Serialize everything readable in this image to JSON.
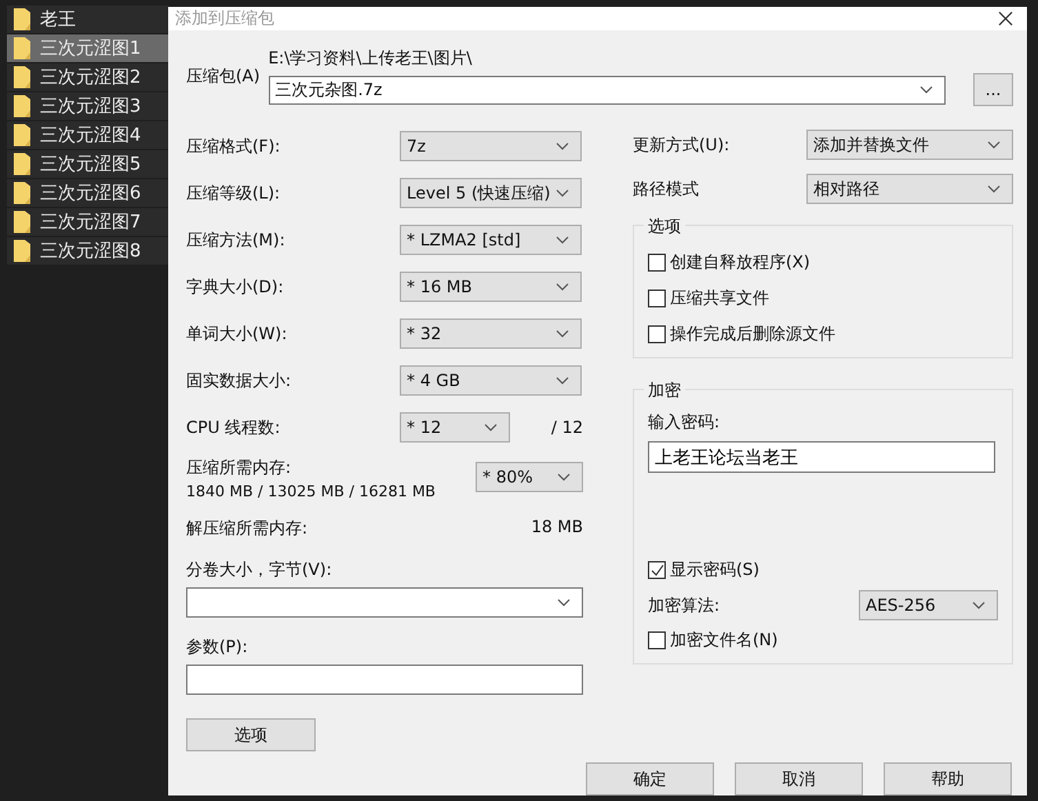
{
  "file_list": [
    {
      "name": "老王",
      "selected": false
    },
    {
      "name": "三次元涩图1",
      "selected": true
    },
    {
      "name": "三次元涩图2",
      "selected": false
    },
    {
      "name": "三次元涩图3",
      "selected": false
    },
    {
      "name": "三次元涩图4",
      "selected": false
    },
    {
      "name": "三次元涩图5",
      "selected": false
    },
    {
      "name": "三次元涩图6",
      "selected": false
    },
    {
      "name": "三次元涩图7",
      "selected": false
    },
    {
      "name": "三次元涩图8",
      "selected": false
    }
  ],
  "dialog": {
    "title": "添加到压缩包",
    "archive": {
      "label": "压缩包(A)",
      "path": "E:\\学习资料\\上传老王\\图片\\",
      "filename": "三次元杂图.7z",
      "browse": "..."
    },
    "settings": [
      {
        "label": "压缩格式(F):",
        "value": "7z"
      },
      {
        "label": "压缩等级(L):",
        "value": "Level 5 (快速压缩)"
      },
      {
        "label": "压缩方法(M):",
        "value": "*  LZMA2 [std]"
      },
      {
        "label": "字典大小(D):",
        "value": "*  16 MB"
      },
      {
        "label": "单词大小(W):",
        "value": "*  32"
      },
      {
        "label": "固实数据大小:",
        "value": "*  4 GB"
      }
    ],
    "cpu": {
      "label": "CPU 线程数:",
      "value": "*  12",
      "max": "/ 12"
    },
    "memory": {
      "label": "压缩所需内存:",
      "detail": "1840 MB / 13025 MB / 16281 MB",
      "value": "* 80%"
    },
    "decompress_memory": {
      "label": "解压缩所需内存:",
      "value": "18 MB"
    },
    "volume": {
      "label": "分卷大小，字节(V):"
    },
    "parameters": {
      "label": "参数(P):"
    },
    "options_button": "选项",
    "update_mode": {
      "label": "更新方式(U):",
      "value": "添加并替换文件"
    },
    "path_mode": {
      "label": "路径模式",
      "value": "相对路径"
    },
    "options": {
      "title": "选项",
      "items": [
        {
          "label": "创建自释放程序(X)",
          "checked": false
        },
        {
          "label": "压缩共享文件",
          "checked": false
        },
        {
          "label": "操作完成后删除源文件",
          "checked": false
        }
      ]
    },
    "encryption": {
      "title": "加密",
      "password_label": "输入密码:",
      "password": "上老王论坛当老王",
      "show_password": {
        "label": "显示密码(S)",
        "checked": true
      },
      "method_label": "加密算法:",
      "method": "AES-256",
      "encrypt_names": {
        "label": "加密文件名(N)",
        "checked": false
      }
    },
    "buttons": [
      "确定",
      "取消",
      "帮助"
    ]
  }
}
